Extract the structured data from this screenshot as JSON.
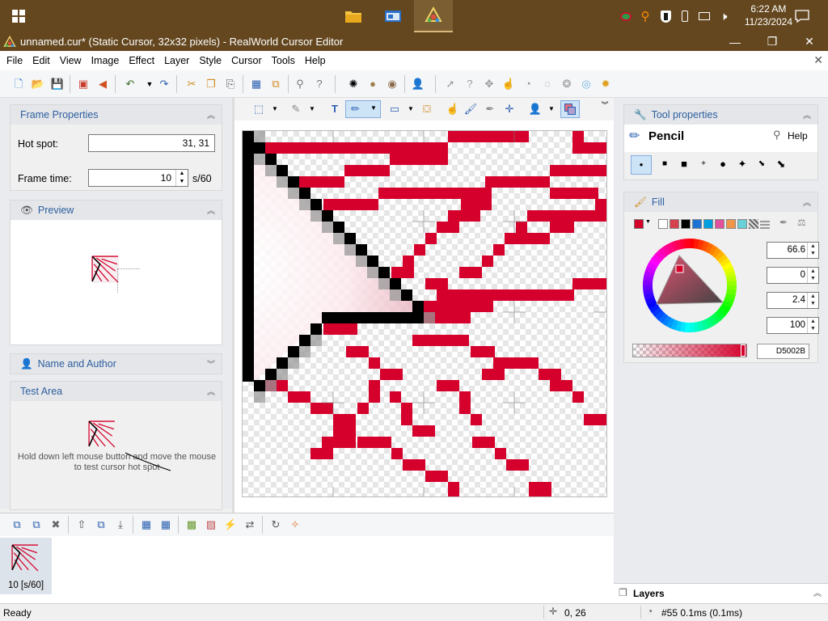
{
  "taskbar": {
    "time": "6:22 AM",
    "date": "11/23/2024"
  },
  "window": {
    "title": "unnamed.cur* (Static Cursor, 32x32 pixels) - RealWorld Cursor Editor",
    "minimize": "—",
    "maximize": "❐",
    "close": "✕"
  },
  "menu": {
    "file": "File",
    "edit": "Edit",
    "view": "View",
    "image": "Image",
    "effect": "Effect",
    "layer": "Layer",
    "style": "Style",
    "cursor": "Cursor",
    "tools": "Tools",
    "help": "Help"
  },
  "frame_properties": {
    "title": "Frame Properties",
    "hotspot_label": "Hot spot:",
    "hotspot_value": "31, 31",
    "frametime_label": "Frame time:",
    "frametime_value": "10",
    "frametime_unit": "s/60"
  },
  "preview": {
    "title": "Preview"
  },
  "name_author": {
    "title": "Name and Author"
  },
  "test_area": {
    "title": "Test Area",
    "hint": "Hold down left mouse button and move the mouse to test cursor hot spot"
  },
  "frames": {
    "frame1_label": "10 [s/60]"
  },
  "tool_properties": {
    "title": "Tool properties",
    "tool_name": "Pencil",
    "help": "Help"
  },
  "fill": {
    "title": "Fill",
    "hue": "66.6",
    "saturation": "0",
    "value": "2.4",
    "alpha": "100",
    "hex": "D5002B",
    "swatches": [
      "#d5002b",
      "#ffffff",
      "#d5424e",
      "#000000",
      "#1e73d2",
      "#00a0e0",
      "#e0529c",
      "#f0964a",
      "#6ad0d8"
    ]
  },
  "layers": {
    "title": "Layers"
  },
  "status": {
    "ready": "Ready",
    "coords": "0, 26",
    "timing": "#55 0.1ms (0.1ms)"
  },
  "colors": {
    "accent": "#d5002b",
    "taskbar": "#64471f",
    "panel_header_text": "#2e5f9e"
  }
}
